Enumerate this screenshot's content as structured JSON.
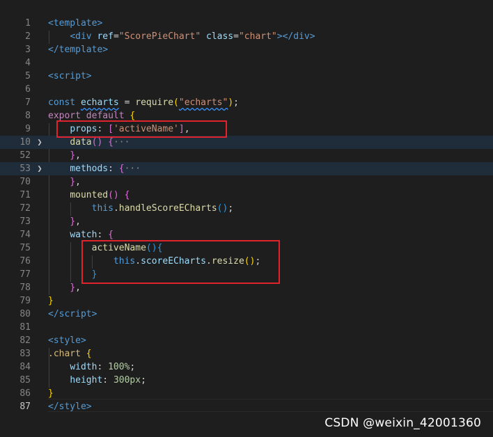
{
  "lines": [
    {
      "num": "1",
      "segs": [
        {
          "t": "<",
          "c": "tag"
        },
        {
          "t": "template",
          "c": "tag"
        },
        {
          "t": ">",
          "c": "tag"
        }
      ]
    },
    {
      "num": "2",
      "segs": [
        {
          "t": "    ",
          "c": "plain"
        },
        {
          "t": "<",
          "c": "tag"
        },
        {
          "t": "div",
          "c": "tag"
        },
        {
          "t": " ",
          "c": "plain"
        },
        {
          "t": "ref",
          "c": "attr"
        },
        {
          "t": "=",
          "c": "plain"
        },
        {
          "t": "\"ScorePieChart\"",
          "c": "str"
        },
        {
          "t": " ",
          "c": "plain"
        },
        {
          "t": "class",
          "c": "attr"
        },
        {
          "t": "=",
          "c": "plain"
        },
        {
          "t": "\"chart\"",
          "c": "str"
        },
        {
          "t": "></",
          "c": "tag"
        },
        {
          "t": "div",
          "c": "tag"
        },
        {
          "t": ">",
          "c": "tag"
        }
      ]
    },
    {
      "num": "3",
      "segs": [
        {
          "t": "</",
          "c": "tag"
        },
        {
          "t": "template",
          "c": "tag"
        },
        {
          "t": ">",
          "c": "tag"
        }
      ]
    },
    {
      "num": "4",
      "segs": []
    },
    {
      "num": "5",
      "segs": [
        {
          "t": "<",
          "c": "tag"
        },
        {
          "t": "script",
          "c": "tag"
        },
        {
          "t": ">",
          "c": "tag"
        }
      ]
    },
    {
      "num": "6",
      "segs": []
    },
    {
      "num": "7",
      "segs": [
        {
          "t": "const",
          "c": "kw"
        },
        {
          "t": " ",
          "c": "plain"
        },
        {
          "t": "echarts",
          "c": "var squig"
        },
        {
          "t": " = ",
          "c": "plain"
        },
        {
          "t": "require",
          "c": "fn"
        },
        {
          "t": "(",
          "c": "p1"
        },
        {
          "t": "\"echarts\"",
          "c": "str squig"
        },
        {
          "t": ")",
          "c": "p1"
        },
        {
          "t": ";",
          "c": "plain"
        }
      ]
    },
    {
      "num": "8",
      "segs": [
        {
          "t": "export",
          "c": "kwc"
        },
        {
          "t": " ",
          "c": "plain"
        },
        {
          "t": "default",
          "c": "kwc"
        },
        {
          "t": " ",
          "c": "plain"
        },
        {
          "t": "{",
          "c": "p1"
        }
      ]
    },
    {
      "num": "9",
      "segs": [
        {
          "t": "    ",
          "c": "plain"
        },
        {
          "t": "props",
          "c": "prop"
        },
        {
          "t": ": ",
          "c": "plain"
        },
        {
          "t": "[",
          "c": "p2"
        },
        {
          "t": "'activeName'",
          "c": "str"
        },
        {
          "t": "]",
          "c": "p2"
        },
        {
          "t": ",",
          "c": "plain"
        }
      ]
    },
    {
      "num": "10",
      "fold": true,
      "hl": true,
      "segs": [
        {
          "t": "    ",
          "c": "plain"
        },
        {
          "t": "data",
          "c": "fn"
        },
        {
          "t": "()",
          "c": "p2"
        },
        {
          "t": " ",
          "c": "plain"
        },
        {
          "t": "{",
          "c": "p2"
        },
        {
          "t": "···",
          "c": "ell"
        }
      ]
    },
    {
      "num": "52",
      "segs": [
        {
          "t": "    ",
          "c": "plain"
        },
        {
          "t": "}",
          "c": "p2"
        },
        {
          "t": ",",
          "c": "plain"
        }
      ]
    },
    {
      "num": "53",
      "fold": true,
      "hl": true,
      "segs": [
        {
          "t": "    ",
          "c": "plain"
        },
        {
          "t": "methods",
          "c": "prop"
        },
        {
          "t": ": ",
          "c": "plain"
        },
        {
          "t": "{",
          "c": "p2"
        },
        {
          "t": "···",
          "c": "ell"
        }
      ]
    },
    {
      "num": "70",
      "segs": [
        {
          "t": "    ",
          "c": "plain"
        },
        {
          "t": "}",
          "c": "p2"
        },
        {
          "t": ",",
          "c": "plain"
        }
      ]
    },
    {
      "num": "71",
      "segs": [
        {
          "t": "    ",
          "c": "plain"
        },
        {
          "t": "mounted",
          "c": "fn"
        },
        {
          "t": "()",
          "c": "p2"
        },
        {
          "t": " ",
          "c": "plain"
        },
        {
          "t": "{",
          "c": "p2"
        }
      ]
    },
    {
      "num": "72",
      "segs": [
        {
          "t": "        ",
          "c": "plain"
        },
        {
          "t": "this",
          "c": "kw"
        },
        {
          "t": ".",
          "c": "plain"
        },
        {
          "t": "handleScoreECharts",
          "c": "fn"
        },
        {
          "t": "()",
          "c": "p3"
        },
        {
          "t": ";",
          "c": "plain"
        }
      ]
    },
    {
      "num": "73",
      "segs": [
        {
          "t": "    ",
          "c": "plain"
        },
        {
          "t": "}",
          "c": "p2"
        },
        {
          "t": ",",
          "c": "plain"
        }
      ]
    },
    {
      "num": "74",
      "segs": [
        {
          "t": "    ",
          "c": "plain"
        },
        {
          "t": "watch",
          "c": "prop"
        },
        {
          "t": ": ",
          "c": "plain"
        },
        {
          "t": "{",
          "c": "p2"
        }
      ]
    },
    {
      "num": "75",
      "segs": [
        {
          "t": "        ",
          "c": "plain"
        },
        {
          "t": "activeName",
          "c": "fn"
        },
        {
          "t": "()",
          "c": "p3"
        },
        {
          "t": "{",
          "c": "p3"
        }
      ]
    },
    {
      "num": "76",
      "segs": [
        {
          "t": "            ",
          "c": "plain"
        },
        {
          "t": "this",
          "c": "kw"
        },
        {
          "t": ".",
          "c": "plain"
        },
        {
          "t": "scoreECharts",
          "c": "var"
        },
        {
          "t": ".",
          "c": "plain"
        },
        {
          "t": "resize",
          "c": "fn"
        },
        {
          "t": "()",
          "c": "p1"
        },
        {
          "t": ";",
          "c": "plain"
        }
      ]
    },
    {
      "num": "77",
      "segs": [
        {
          "t": "        ",
          "c": "plain"
        },
        {
          "t": "}",
          "c": "p3"
        }
      ]
    },
    {
      "num": "78",
      "segs": [
        {
          "t": "    ",
          "c": "plain"
        },
        {
          "t": "}",
          "c": "p2"
        },
        {
          "t": ",",
          "c": "plain"
        }
      ]
    },
    {
      "num": "79",
      "segs": [
        {
          "t": "}",
          "c": "p1"
        }
      ]
    },
    {
      "num": "80",
      "segs": [
        {
          "t": "</",
          "c": "tag"
        },
        {
          "t": "script",
          "c": "tag"
        },
        {
          "t": ">",
          "c": "tag"
        }
      ]
    },
    {
      "num": "81",
      "segs": []
    },
    {
      "num": "82",
      "segs": [
        {
          "t": "<",
          "c": "tag"
        },
        {
          "t": "style",
          "c": "tag"
        },
        {
          "t": ">",
          "c": "tag"
        }
      ]
    },
    {
      "num": "83",
      "segs": [
        {
          "t": ".chart",
          "c": "sel"
        },
        {
          "t": " ",
          "c": "plain"
        },
        {
          "t": "{",
          "c": "p1"
        }
      ]
    },
    {
      "num": "84",
      "segs": [
        {
          "t": "    ",
          "c": "plain"
        },
        {
          "t": "width",
          "c": "prop"
        },
        {
          "t": ": ",
          "c": "plain"
        },
        {
          "t": "100%",
          "c": "num"
        },
        {
          "t": ";",
          "c": "plain"
        }
      ]
    },
    {
      "num": "85",
      "segs": [
        {
          "t": "    ",
          "c": "plain"
        },
        {
          "t": "height",
          "c": "prop"
        },
        {
          "t": ": ",
          "c": "plain"
        },
        {
          "t": "300px",
          "c": "num"
        },
        {
          "t": ";",
          "c": "plain"
        }
      ]
    },
    {
      "num": "86",
      "segs": [
        {
          "t": "}",
          "c": "p1"
        }
      ]
    },
    {
      "num": "87",
      "active": true,
      "segs": [
        {
          "t": "</",
          "c": "tag"
        },
        {
          "t": "style",
          "c": "tag"
        },
        {
          "t": ">",
          "c": "tag"
        }
      ]
    }
  ],
  "watermark": "CSDN @weixin_42001360",
  "icons": {
    "fold": "chevron-right-icon"
  },
  "colors": {
    "background": "#1e1e1e",
    "highlight_box": "#e0232d"
  }
}
